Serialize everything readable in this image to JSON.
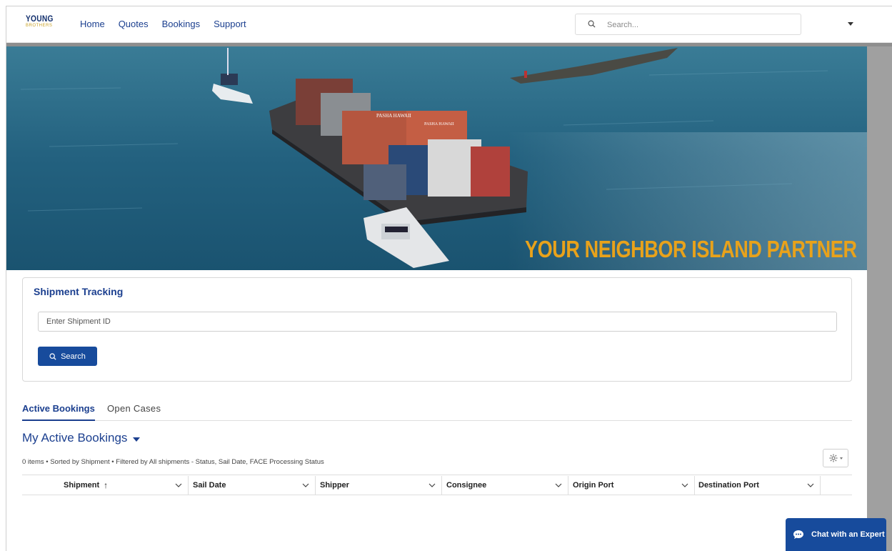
{
  "header": {
    "logo_text": "YOUNG",
    "logo_subtext": "BROTHERS",
    "nav": [
      "Home",
      "Quotes",
      "Bookings",
      "Support"
    ],
    "search_placeholder": "Search..."
  },
  "hero": {
    "tagline": "YOUR NEIGHBOR ISLAND PARTNER",
    "container_text_1": "PASHA HAWAII",
    "container_text_2": "PASHA HAWAII"
  },
  "tracking": {
    "title": "Shipment Tracking",
    "input_placeholder": "Enter Shipment ID",
    "search_label": "Search"
  },
  "tabs": [
    "Active Bookings",
    "Open Cases"
  ],
  "list": {
    "title": "My Active Bookings",
    "meta": "0 items • Sorted by Shipment • Filtered by All shipments - Status, Sail Date, FACE Processing Status",
    "columns": [
      "Shipment",
      "Sail Date",
      "Shipper",
      "Consignee",
      "Origin Port",
      "Destination Port"
    ],
    "sort_indicator": "↑"
  },
  "chat": {
    "label": "Chat with an Expert"
  },
  "colors": {
    "brand_blue": "#174b9c",
    "link_blue": "#1b3f8f",
    "tagline_gold": "#e8a21b"
  }
}
